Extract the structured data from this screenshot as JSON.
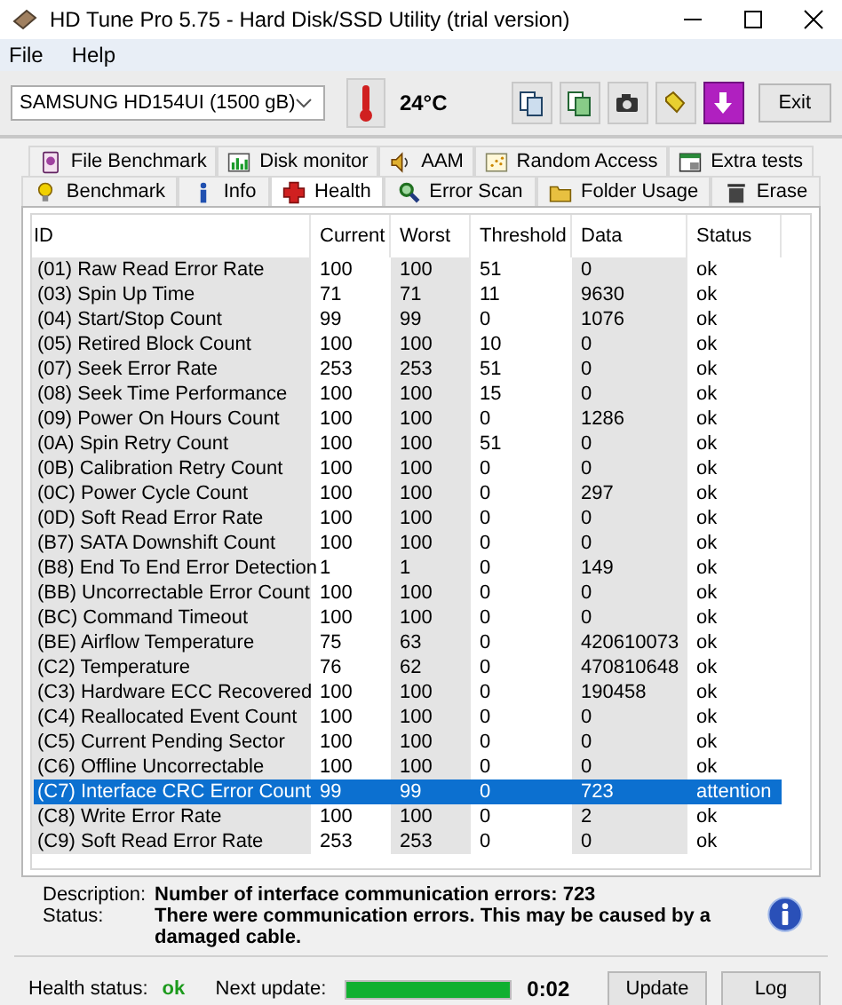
{
  "window": {
    "title": "HD Tune Pro 5.75 - Hard Disk/SSD Utility (trial version)"
  },
  "menu": [
    "File",
    "Help"
  ],
  "toolbar": {
    "drive": "SAMSUNG HD154UI (1500 gB)",
    "temperature": "24°C",
    "exit": "Exit"
  },
  "tab_rows": [
    {
      "tabs": [
        {
          "label": "File Benchmark",
          "selected": false
        },
        {
          "label": "Disk monitor",
          "selected": false
        },
        {
          "label": "AAM",
          "selected": false
        },
        {
          "label": "Random Access",
          "selected": false
        },
        {
          "label": "Extra tests",
          "selected": false
        }
      ]
    },
    {
      "tabs": [
        {
          "label": "Benchmark",
          "selected": false
        },
        {
          "label": "Info",
          "selected": false
        },
        {
          "label": "Health",
          "selected": true
        },
        {
          "label": "Error Scan",
          "selected": false
        },
        {
          "label": "Folder Usage",
          "selected": false
        },
        {
          "label": "Erase",
          "selected": false
        }
      ]
    }
  ],
  "table": {
    "columns": [
      "ID",
      "Current",
      "Worst",
      "Threshold",
      "Data",
      "Status"
    ],
    "rows": [
      {
        "cells": [
          "(01) Raw Read Error Rate",
          "100",
          "100",
          "51",
          "0",
          "ok"
        ],
        "selected": false
      },
      {
        "cells": [
          "(03) Spin Up Time",
          "71",
          "71",
          "11",
          "9630",
          "ok"
        ],
        "selected": false
      },
      {
        "cells": [
          "(04) Start/Stop Count",
          "99",
          "99",
          "0",
          "1076",
          "ok"
        ],
        "selected": false
      },
      {
        "cells": [
          "(05) Retired Block Count",
          "100",
          "100",
          "10",
          "0",
          "ok"
        ],
        "selected": false
      },
      {
        "cells": [
          "(07) Seek Error Rate",
          "253",
          "253",
          "51",
          "0",
          "ok"
        ],
        "selected": false
      },
      {
        "cells": [
          "(08) Seek Time Performance",
          "100",
          "100",
          "15",
          "0",
          "ok"
        ],
        "selected": false
      },
      {
        "cells": [
          "(09) Power On Hours Count",
          "100",
          "100",
          "0",
          "1286",
          "ok"
        ],
        "selected": false
      },
      {
        "cells": [
          "(0A) Spin Retry Count",
          "100",
          "100",
          "51",
          "0",
          "ok"
        ],
        "selected": false
      },
      {
        "cells": [
          "(0B) Calibration Retry Count",
          "100",
          "100",
          "0",
          "0",
          "ok"
        ],
        "selected": false
      },
      {
        "cells": [
          "(0C) Power Cycle Count",
          "100",
          "100",
          "0",
          "297",
          "ok"
        ],
        "selected": false
      },
      {
        "cells": [
          "(0D) Soft Read Error Rate",
          "100",
          "100",
          "0",
          "0",
          "ok"
        ],
        "selected": false
      },
      {
        "cells": [
          "(B7) SATA Downshift Count",
          "100",
          "100",
          "0",
          "0",
          "ok"
        ],
        "selected": false
      },
      {
        "cells": [
          "(B8) End To End Error Detection",
          "1",
          "1",
          "0",
          "149",
          "ok"
        ],
        "selected": false
      },
      {
        "cells": [
          "(BB) Uncorrectable Error Count",
          "100",
          "100",
          "0",
          "0",
          "ok"
        ],
        "selected": false
      },
      {
        "cells": [
          "(BC) Command Timeout",
          "100",
          "100",
          "0",
          "0",
          "ok"
        ],
        "selected": false
      },
      {
        "cells": [
          "(BE) Airflow Temperature",
          "75",
          "63",
          "0",
          "420610073",
          "ok"
        ],
        "selected": false
      },
      {
        "cells": [
          "(C2) Temperature",
          "76",
          "62",
          "0",
          "470810648",
          "ok"
        ],
        "selected": false
      },
      {
        "cells": [
          "(C3) Hardware ECC Recovered",
          "100",
          "100",
          "0",
          "190458",
          "ok"
        ],
        "selected": false
      },
      {
        "cells": [
          "(C4) Reallocated Event Count",
          "100",
          "100",
          "0",
          "0",
          "ok"
        ],
        "selected": false
      },
      {
        "cells": [
          "(C5) Current Pending Sector",
          "100",
          "100",
          "0",
          "0",
          "ok"
        ],
        "selected": false
      },
      {
        "cells": [
          "(C6) Offline Uncorrectable",
          "100",
          "100",
          "0",
          "0",
          "ok"
        ],
        "selected": false
      },
      {
        "cells": [
          "(C7) Interface CRC Error Count",
          "99",
          "99",
          "0",
          "723",
          "attention"
        ],
        "selected": true
      },
      {
        "cells": [
          "(C8) Write Error Rate",
          "100",
          "100",
          "0",
          "2",
          "ok"
        ],
        "selected": false
      },
      {
        "cells": [
          "(C9) Soft Read Error Rate",
          "253",
          "253",
          "0",
          "0",
          "ok"
        ],
        "selected": false
      }
    ]
  },
  "details": {
    "description_label": "Description:",
    "description": "Number of interface communication errors: 723",
    "status_label": "Status:",
    "status": "There were communication errors. This may be caused by a damaged cable."
  },
  "status_bar": {
    "health_label": "Health status:",
    "health": "ok",
    "next_label": "Next update:",
    "level": 1,
    "countdown": "0:02",
    "buttons": [
      "Update",
      "Log"
    ]
  }
}
